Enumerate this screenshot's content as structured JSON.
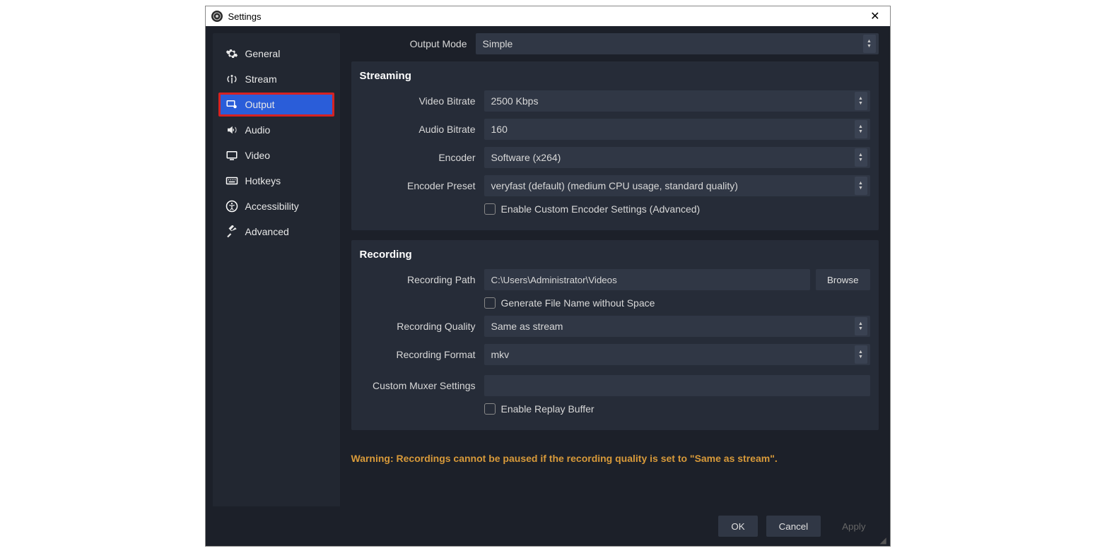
{
  "window": {
    "title": "Settings"
  },
  "sidebar": {
    "items": [
      {
        "label": "General"
      },
      {
        "label": "Stream"
      },
      {
        "label": "Output"
      },
      {
        "label": "Audio"
      },
      {
        "label": "Video"
      },
      {
        "label": "Hotkeys"
      },
      {
        "label": "Accessibility"
      },
      {
        "label": "Advanced"
      }
    ]
  },
  "output_mode": {
    "label": "Output Mode",
    "value": "Simple"
  },
  "streaming": {
    "title": "Streaming",
    "video_bitrate": {
      "label": "Video Bitrate",
      "value": "2500 Kbps"
    },
    "audio_bitrate": {
      "label": "Audio Bitrate",
      "value": "160"
    },
    "encoder": {
      "label": "Encoder",
      "value": "Software (x264)"
    },
    "encoder_preset": {
      "label": "Encoder Preset",
      "value": "veryfast (default) (medium CPU usage, standard quality)"
    },
    "enable_custom": {
      "label": "Enable Custom Encoder Settings (Advanced)"
    }
  },
  "recording": {
    "title": "Recording",
    "path": {
      "label": "Recording Path",
      "value": "C:\\Users\\Administrator\\Videos",
      "browse": "Browse"
    },
    "gen_no_space": {
      "label": "Generate File Name without Space"
    },
    "quality": {
      "label": "Recording Quality",
      "value": "Same as stream"
    },
    "format": {
      "label": "Recording Format",
      "value": "mkv"
    },
    "muxer": {
      "label": "Custom Muxer Settings",
      "value": ""
    },
    "replay_buffer": {
      "label": "Enable Replay Buffer"
    }
  },
  "warning": "Warning: Recordings cannot be paused if the recording quality is set to \"Same as stream\".",
  "footer": {
    "ok": "OK",
    "cancel": "Cancel",
    "apply": "Apply"
  }
}
